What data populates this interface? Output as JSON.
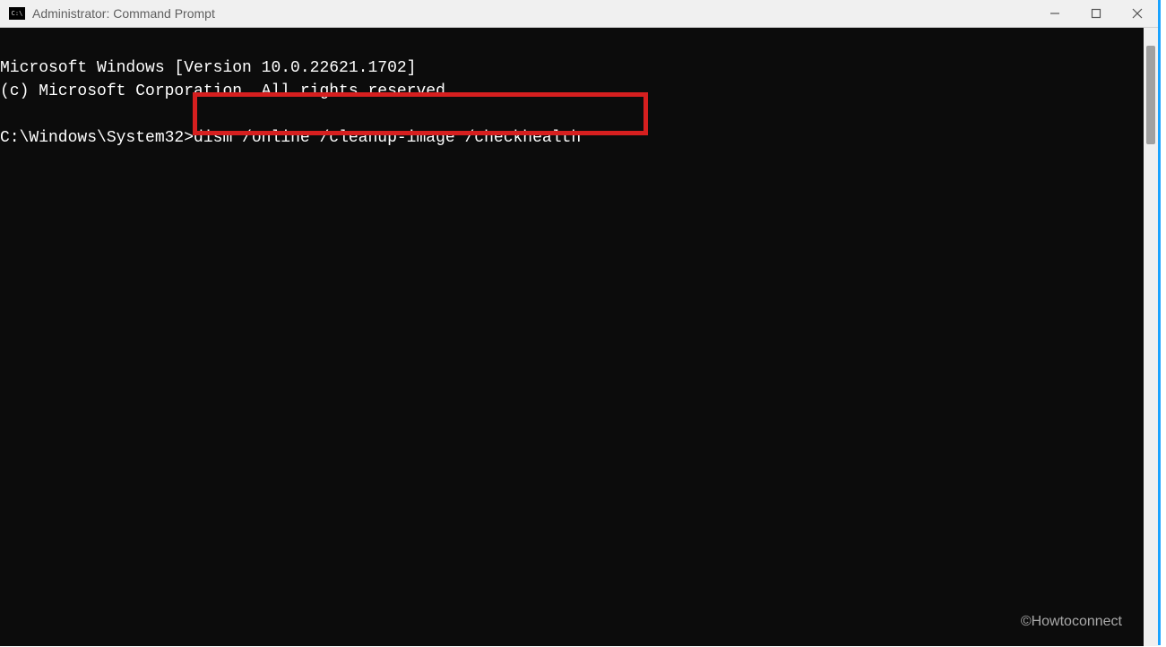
{
  "titlebar": {
    "icon_name": "cmd-icon",
    "title": "Administrator: Command Prompt"
  },
  "window_controls": {
    "minimize_name": "minimize-icon",
    "maximize_name": "maximize-icon",
    "close_name": "close-icon"
  },
  "terminal": {
    "line1": "Microsoft Windows [Version 10.0.22621.1702]",
    "line2": "(c) Microsoft Corporation. All rights reserved.",
    "blank": "",
    "prompt": "C:\\Windows\\System32>",
    "command": "dism /online /cleanup-image /checkhealth"
  },
  "highlight": {
    "color": "#d61f1f"
  },
  "watermark": "©Howtoconnect"
}
